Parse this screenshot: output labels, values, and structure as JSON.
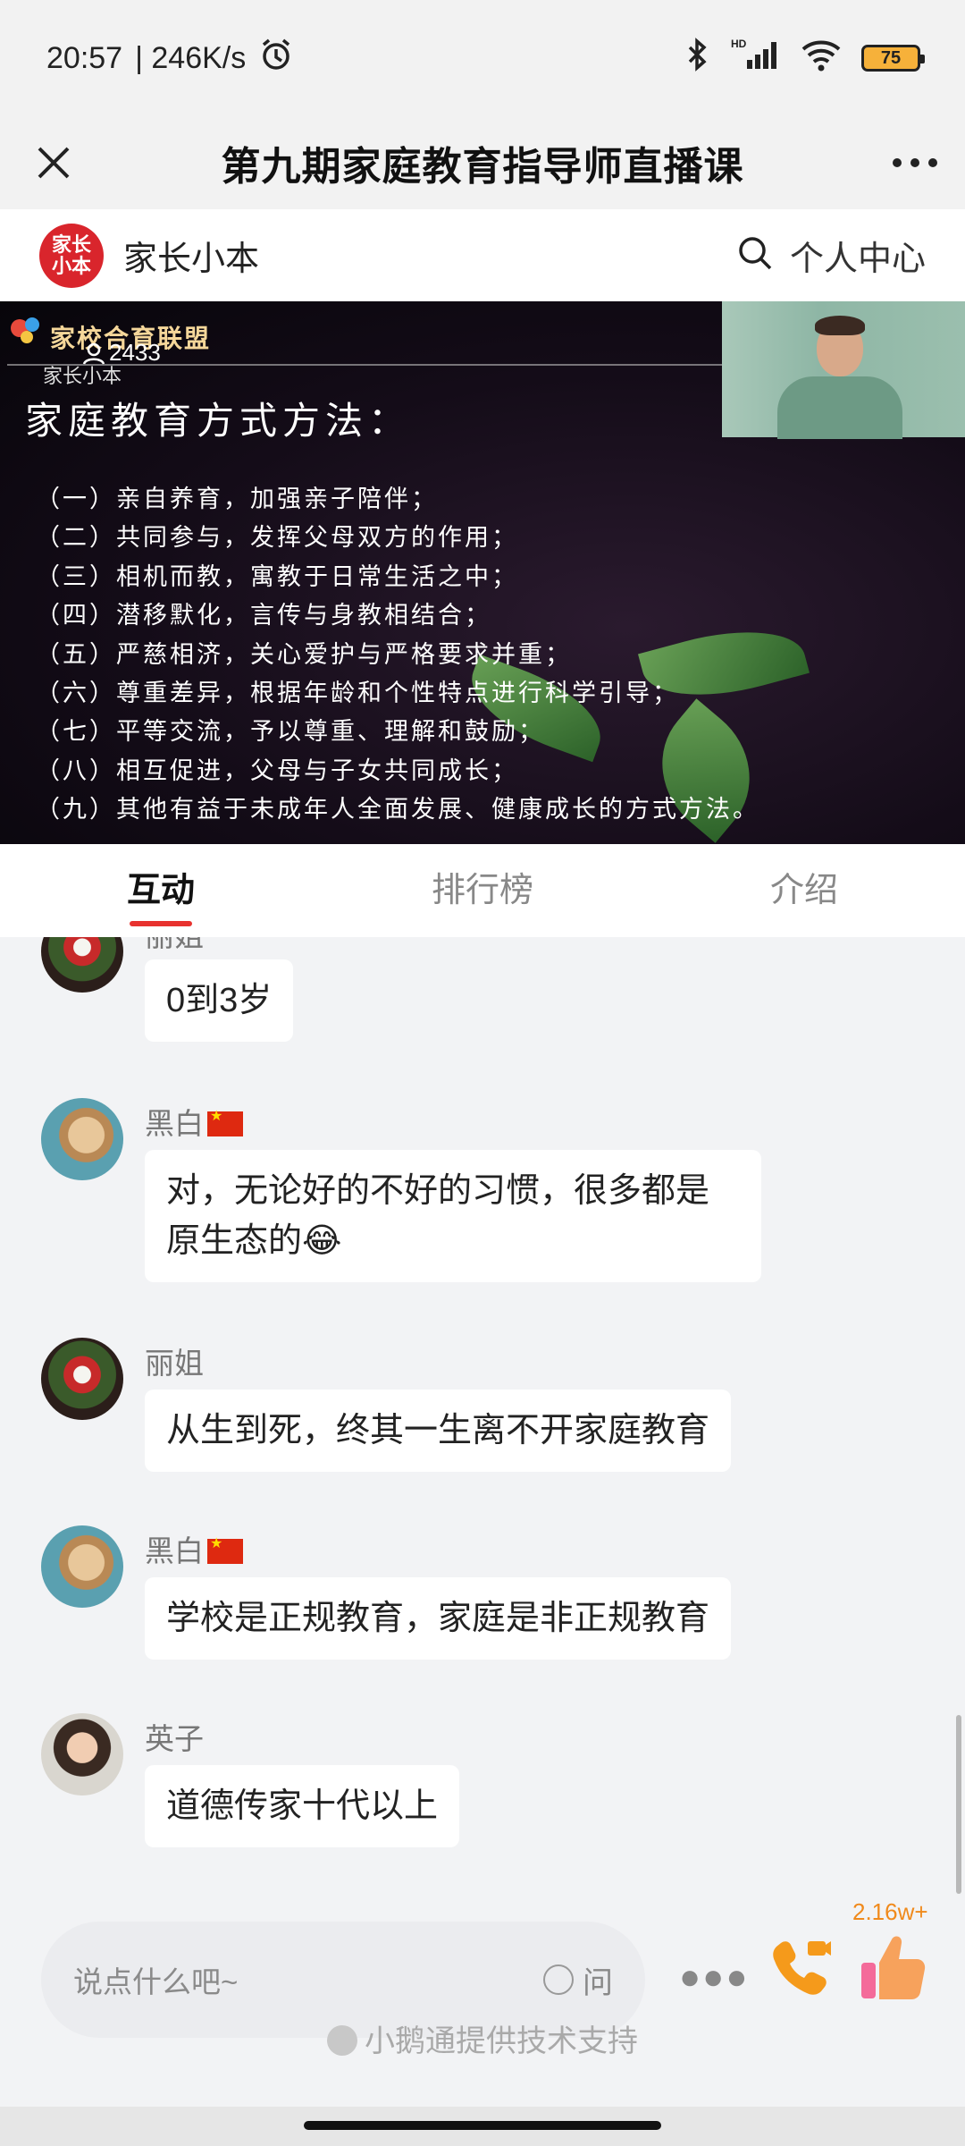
{
  "status_bar": {
    "time": "20:57",
    "speed": "| 246K/s",
    "battery": "75",
    "icons": [
      "alarm-icon",
      "bluetooth-icon",
      "signal-icon",
      "wifi-icon",
      "battery-icon"
    ]
  },
  "title_bar": {
    "title": "第九期家庭教育指导师直播课",
    "close_icon": "close-icon",
    "more_icon": "more-icon"
  },
  "app_header": {
    "logo_text": "家长\n小本",
    "brand": "家长小本",
    "personal_center": "个人中心"
  },
  "video": {
    "union_name": "家校合育联盟",
    "viewer_count": "2433",
    "sub_brand": "家长小本",
    "slide_title": "家庭教育方式方法：",
    "slide_items": [
      "（一）亲自养育，加强亲子陪伴；",
      "（二）共同参与，发挥父母双方的作用；",
      "（三）相机而教，寓教于日常生活之中；",
      "（四）潜移默化，言传与身教相结合；",
      "（五）严慈相济，关心爱护与严格要求并重；",
      "（六）尊重差异，根据年龄和个性特点进行科学引导；",
      "（七）平等交流，予以尊重、理解和鼓励；",
      "（八）相互促进，父母与子女共同成长；",
      "（九）其他有益于未成年人全面发展、健康成长的方式方法。"
    ]
  },
  "tabs": [
    {
      "label": "互动",
      "active": true
    },
    {
      "label": "排行榜",
      "active": false
    },
    {
      "label": "介绍",
      "active": false
    }
  ],
  "messages": [
    {
      "nick": "丽姐",
      "text": "0到3岁"
    },
    {
      "nick": "黑白",
      "text_line1": "对，无论好的不好的习惯，很多都是",
      "text_line2": "原生态的😂"
    },
    {
      "nick": "丽姐",
      "text": "从生到死，终其一生离不开家庭教育"
    },
    {
      "nick": "黑白",
      "text": "学校是正规教育，家庭是非正规教育"
    },
    {
      "nick": "英子",
      "text": "道德传家十代以上"
    }
  ],
  "bottom": {
    "input_placeholder": "说点什么吧~",
    "ask_label": "问",
    "like_count": "2.16w+",
    "support_text": "小鹅通提供技术支持"
  },
  "colors": {
    "accent_red": "#e8322f",
    "like_orange": "#f08a1c"
  }
}
